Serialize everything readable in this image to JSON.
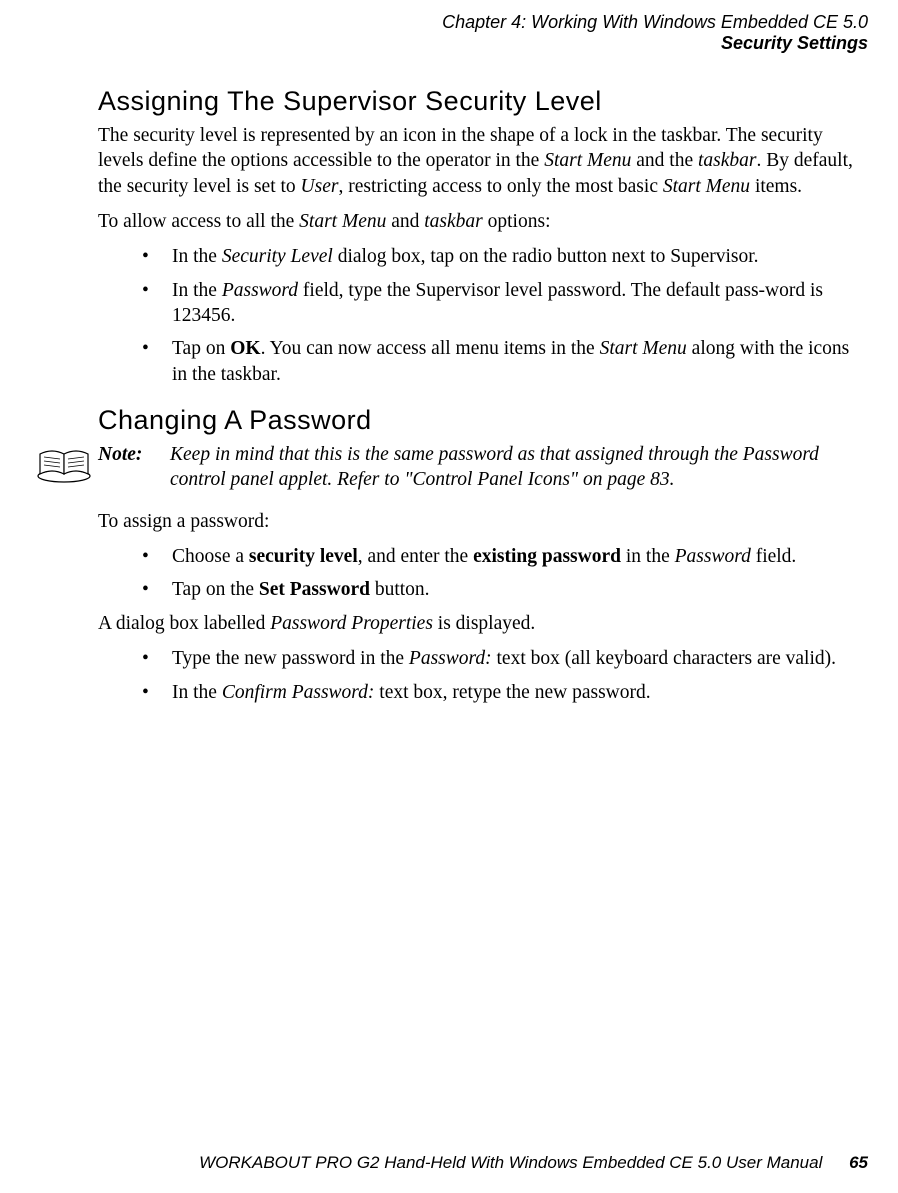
{
  "header": {
    "chapter": "Chapter 4: Working With Windows Embedded CE 5.0",
    "section": "Security Settings"
  },
  "s1": {
    "title": "Assigning The Supervisor Security Level",
    "p1_a": "The security level is represented by an icon in the shape of a lock in the taskbar. The security levels define the options accessible to the operator in the ",
    "p1_b": "Start Menu",
    "p1_c": " and the ",
    "p1_d": "taskbar",
    "p1_e": ". By default, the security level is set to ",
    "p1_f": "User",
    "p1_g": ", restricting access to only the most basic ",
    "p1_h": "Start Menu",
    "p1_i": " items.",
    "p2_a": "To allow access to all the ",
    "p2_b": "Start Menu",
    "p2_c": " and ",
    "p2_d": "taskbar",
    "p2_e": " options:",
    "li1_a": "In the ",
    "li1_b": "Security Level",
    "li1_c": " dialog box, tap on the radio button next to Supervisor.",
    "li2_a": "In the ",
    "li2_b": "Password",
    "li2_c": " field, type the Supervisor level password. The default pass-word is 123456.",
    "li3_a": "Tap on ",
    "li3_b": "OK",
    "li3_c": ". You can now access all menu items in the ",
    "li3_d": "Start Menu",
    "li3_e": " along with the icons in the taskbar."
  },
  "s2": {
    "title": "Changing A Password",
    "note_label": "Note:",
    "note_body": "Keep in mind that this is the same password as that assigned through the Password control panel applet. Refer to \"Control Panel Icons\" on page 83.",
    "p1": "To assign a password:",
    "li1_a": "Choose a ",
    "li1_b": "security level",
    "li1_c": ", and enter the ",
    "li1_d": "existing password",
    "li1_e": " in the ",
    "li1_f": "Password",
    "li1_g": " field.",
    "li2_a": "Tap on the ",
    "li2_b": "Set Password",
    "li2_c": " button.",
    "p2_a": "A dialog box labelled ",
    "p2_b": "Password Properties",
    "p2_c": " is displayed.",
    "li3_a": "Type the new password in the ",
    "li3_b": "Password:",
    "li3_c": " text box (all keyboard characters are valid).",
    "li4_a": "In the ",
    "li4_b": "Confirm Password:",
    "li4_c": " text box, retype the new password."
  },
  "footer": {
    "manual": "WORKABOUT PRO G2 Hand-Held With Windows Embedded CE 5.0 User Manual",
    "page": "65"
  }
}
